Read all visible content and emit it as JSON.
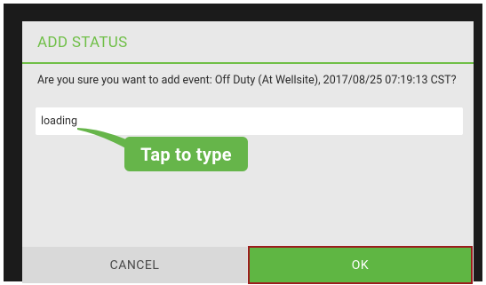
{
  "dialog": {
    "title": "ADD STATUS",
    "message": "Are you sure you want to add event: Off Duty (At Wellsite), 2017/08/25 07:19:13 CST?",
    "input_value": "loading",
    "tooltip": "Tap to type",
    "cancel_label": "CANCEL",
    "ok_label": "OK"
  },
  "colors": {
    "accent": "#6fbf47",
    "button_ok": "#5fb643",
    "highlight_border": "#9b1d1d"
  }
}
